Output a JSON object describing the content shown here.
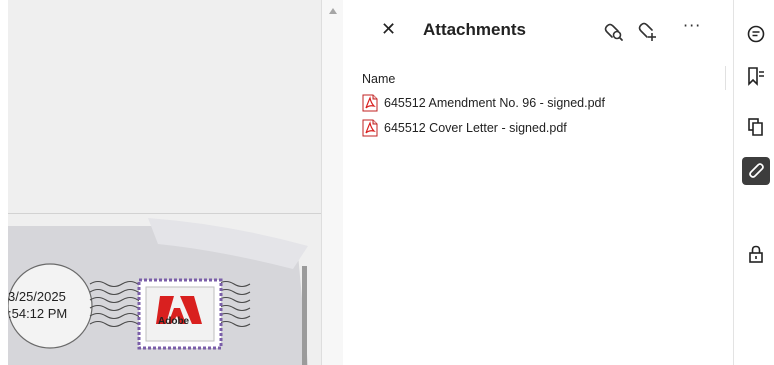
{
  "document": {
    "stamp_date": "3/25/2025",
    "stamp_time": ":54:12 PM",
    "stamp_brand": "Adobe"
  },
  "panel": {
    "title": "Attachments",
    "more_label": "···",
    "column_header": "Name",
    "files": [
      {
        "name": "645512 Amendment No. 96 - signed.pdf"
      },
      {
        "name": "645512 Cover Letter - signed.pdf"
      }
    ]
  },
  "rail": {
    "active_item": "attachments"
  },
  "colors": {
    "accent_dark": "#3d3d3d",
    "pdf_red": "#d9201f",
    "stamp_purple": "#7a5ea8"
  }
}
